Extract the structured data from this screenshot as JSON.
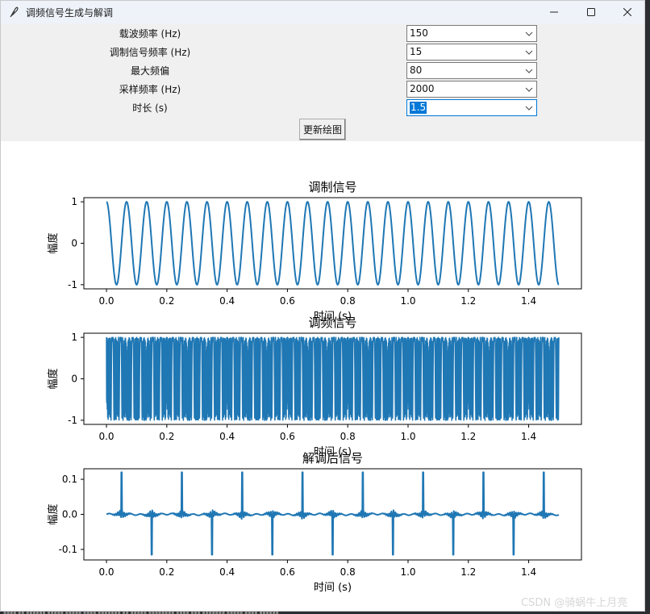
{
  "window": {
    "title": "调频信号生成与解调",
    "icon": "feather-icon"
  },
  "controls": {
    "minimize_icon": "minimize-icon",
    "maximize_icon": "maximize-icon",
    "close_icon": "close-icon"
  },
  "form": {
    "fields": [
      {
        "label": "载波频率 (Hz)",
        "value": "150"
      },
      {
        "label": "调制信号频率 (Hz)",
        "value": "15"
      },
      {
        "label": "最大频偏",
        "value": "80"
      },
      {
        "label": "采样频率 (Hz)",
        "value": "2000"
      },
      {
        "label": "时长 (s)",
        "value": "1.5"
      }
    ],
    "update_button": "更新绘图"
  },
  "chart_data": [
    {
      "type": "line",
      "title": "调制信号",
      "xlabel": "时间 (s)",
      "ylabel": "幅度",
      "signal": "cosine",
      "frequency_hz": 15,
      "amplitude": 1,
      "x_range": [
        0,
        1.5
      ],
      "xlim": [
        -0.075,
        1.575
      ],
      "ylim": [
        -1.1,
        1.1
      ],
      "xticks": [
        "0.0",
        "0.2",
        "0.4",
        "0.6",
        "0.8",
        "1.0",
        "1.2",
        "1.4"
      ],
      "yticks": [
        "1",
        "0",
        "-1"
      ],
      "color": "#1f77b4"
    },
    {
      "type": "line",
      "title": "调频信号",
      "xlabel": "时间 (s)",
      "ylabel": "幅度",
      "signal": "fm",
      "carrier_hz": 150,
      "modulation_hz": 15,
      "max_deviation": 80,
      "sample_rate_hz": 2000,
      "x_range": [
        0,
        1.5
      ],
      "xlim": [
        -0.075,
        1.575
      ],
      "ylim": [
        -1.1,
        1.1
      ],
      "xticks": [
        "0.0",
        "0.2",
        "0.4",
        "0.6",
        "0.8",
        "1.0",
        "1.2",
        "1.4"
      ],
      "yticks": [
        "1",
        "0",
        "-1"
      ],
      "color": "#1f77b4"
    },
    {
      "type": "line",
      "title": "解调后信号",
      "xlabel": "时间 (s)",
      "ylabel": "幅度",
      "signal": "demodulated",
      "baseline": 0.0,
      "positive_spikes": [
        {
          "x": 0.05,
          "y": 0.12
        },
        {
          "x": 0.25,
          "y": 0.12
        },
        {
          "x": 0.45,
          "y": 0.12
        },
        {
          "x": 0.65,
          "y": 0.12
        },
        {
          "x": 0.85,
          "y": 0.12
        },
        {
          "x": 1.05,
          "y": 0.12
        },
        {
          "x": 1.25,
          "y": 0.12
        },
        {
          "x": 1.45,
          "y": 0.12
        }
      ],
      "negative_spikes": [
        {
          "x": 0.15,
          "y": -0.115
        },
        {
          "x": 0.35,
          "y": -0.115
        },
        {
          "x": 0.55,
          "y": -0.115
        },
        {
          "x": 0.75,
          "y": -0.115
        },
        {
          "x": 0.95,
          "y": -0.115
        },
        {
          "x": 1.15,
          "y": -0.115
        },
        {
          "x": 1.35,
          "y": -0.115
        }
      ],
      "x_range": [
        0,
        1.5
      ],
      "xlim": [
        -0.075,
        1.575
      ],
      "ylim": [
        -0.13,
        0.13
      ],
      "xticks": [
        "0.0",
        "0.2",
        "0.4",
        "0.6",
        "0.8",
        "1.0",
        "1.2",
        "1.4"
      ],
      "yticks": [
        "0.1",
        "0.0",
        "-0.1"
      ],
      "color": "#1f77b4"
    }
  ],
  "watermark": "CSDN @骑蜗牛上月亮"
}
